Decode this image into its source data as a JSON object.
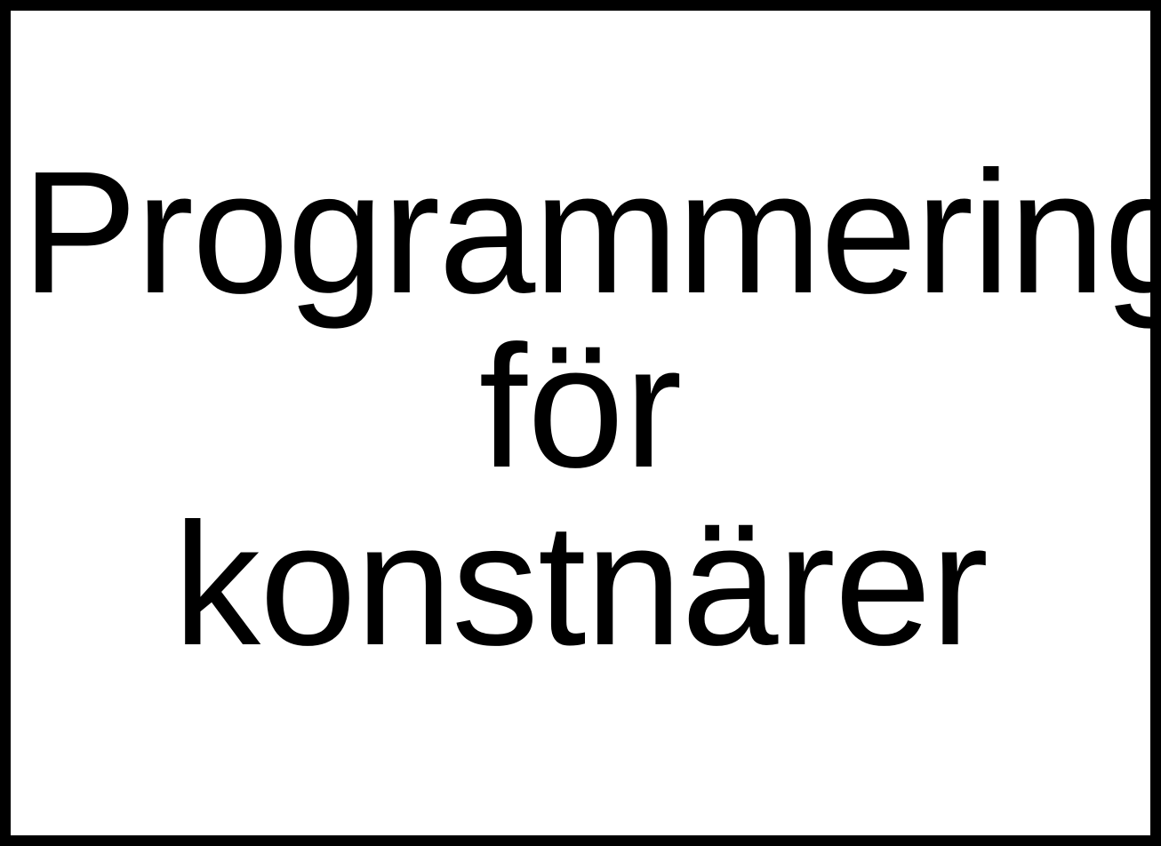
{
  "title": {
    "line1": "Programmering",
    "line2": "för",
    "line3": "konstnärer"
  },
  "colors": {
    "background": "#ffffff",
    "text": "#000000",
    "border": "#000000"
  }
}
